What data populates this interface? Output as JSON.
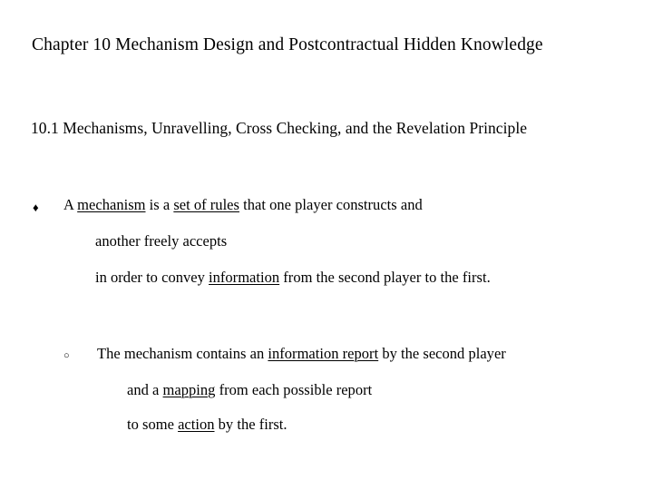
{
  "slide": {
    "background_color": "#ffffff",
    "text_color": "#000000",
    "title": "Chapter 10   Mechanism Design and Postcontractual Hidden Knowledge",
    "section_heading": "10.1   Mechanisms, Unravelling, Cross Checking, and the Revelation Principle"
  },
  "bullets": [
    {
      "marker": "diamond-bullet",
      "marker_glyph": "♦",
      "level": 1,
      "lines": [
        {
          "segments": [
            {
              "text": "A ",
              "underline": false
            },
            {
              "text": "mechanism",
              "underline": true
            },
            {
              "text": " is a ",
              "underline": false
            },
            {
              "text": "set of rules",
              "underline": true
            },
            {
              "text": " that one player constructs and",
              "underline": false
            }
          ]
        },
        {
          "segments": [
            {
              "text": "another freely accepts",
              "underline": false
            }
          ]
        },
        {
          "segments": [
            {
              "text": "in order to convey ",
              "underline": false
            },
            {
              "text": "information",
              "underline": true
            },
            {
              "text": " from the second player to the first.",
              "underline": false
            }
          ]
        }
      ]
    },
    {
      "marker": "circle-bullet",
      "marker_glyph": "○",
      "level": 2,
      "lines": [
        {
          "segments": [
            {
              "text": "The mechanism contains an ",
              "underline": false
            },
            {
              "text": "information report",
              "underline": true
            },
            {
              "text": " by the second player",
              "underline": false
            }
          ]
        },
        {
          "segments": [
            {
              "text": "and a ",
              "underline": false
            },
            {
              "text": "mapping",
              "underline": true
            },
            {
              "text": " from each possible report",
              "underline": false
            }
          ]
        },
        {
          "segments": [
            {
              "text": "to some ",
              "underline": false
            },
            {
              "text": "action",
              "underline": true
            },
            {
              "text": " by the first.",
              "underline": false
            }
          ]
        }
      ]
    }
  ]
}
